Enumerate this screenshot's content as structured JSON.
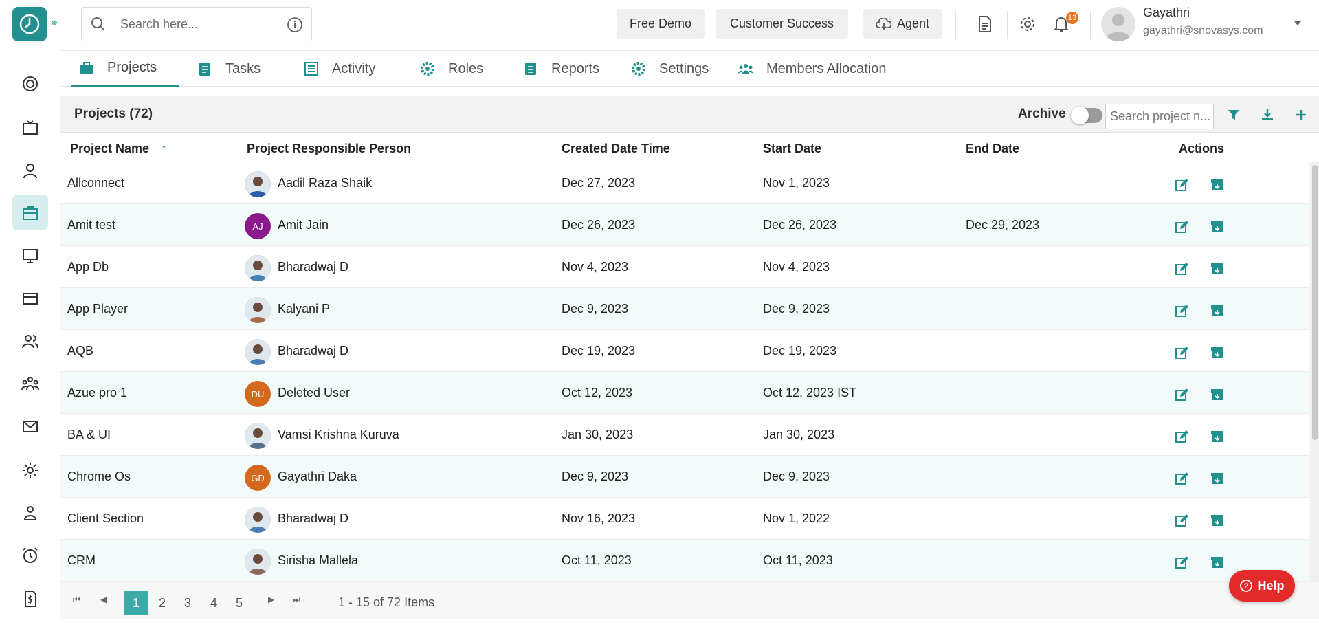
{
  "topbar": {
    "search_placeholder": "Search here...",
    "free_demo": "Free Demo",
    "customer_success": "Customer Success",
    "agent": "Agent",
    "notification_count": "13",
    "user_name": "Gayathri",
    "user_email": "gayathri@snovasys.com"
  },
  "tabs": [
    {
      "label": "Projects",
      "icon": "briefcase-icon"
    },
    {
      "label": "Tasks",
      "icon": "clipboard-icon"
    },
    {
      "label": "Activity",
      "icon": "list-icon"
    },
    {
      "label": "Roles",
      "icon": "gear-icon"
    },
    {
      "label": "Reports",
      "icon": "document-icon"
    },
    {
      "label": "Settings",
      "icon": "settings-icon"
    },
    {
      "label": "Members Allocation",
      "icon": "users-icon"
    }
  ],
  "panel": {
    "title": "Projects (72)",
    "archive_label": "Archive",
    "search_placeholder": "Search project n..."
  },
  "columns": [
    "Project Name",
    "Project Responsible Person",
    "Created Date Time",
    "Start Date",
    "End Date",
    "Actions"
  ],
  "rows": [
    {
      "name": "Allconnect",
      "person": "Aadil Raza Shaik",
      "initials": "",
      "avatar_color": "#2d5fa8",
      "created": "Dec 27, 2023",
      "start": "Nov 1, 2023",
      "end": ""
    },
    {
      "name": "Amit test",
      "person": "Amit Jain",
      "initials": "AJ",
      "avatar_color": "#8a1a8c",
      "created": "Dec 26, 2023",
      "start": "Dec 26, 2023",
      "end": "Dec 29, 2023"
    },
    {
      "name": "App Db",
      "person": "Bharadwaj D",
      "initials": "",
      "avatar_color": "#4a7fb5",
      "created": "Nov 4, 2023",
      "start": "Nov 4, 2023",
      "end": ""
    },
    {
      "name": "App Player",
      "person": "Kalyani P",
      "initials": "",
      "avatar_color": "#a8684c",
      "created": "Dec 9, 2023",
      "start": "Dec 9, 2023",
      "end": ""
    },
    {
      "name": "AQB",
      "person": "Bharadwaj D",
      "initials": "",
      "avatar_color": "#4a7fb5",
      "created": "Dec 19, 2023",
      "start": "Dec 19, 2023",
      "end": ""
    },
    {
      "name": "Azue pro 1",
      "person": "Deleted User",
      "initials": "DU",
      "avatar_color": "#d2691e",
      "created": "Oct 12, 2023",
      "start": "Oct 12, 2023 IST",
      "end": ""
    },
    {
      "name": "BA & UI",
      "person": "Vamsi Krishna Kuruva",
      "initials": "",
      "avatar_color": "#5a6f8a",
      "created": "Jan 30, 2023",
      "start": "Jan 30, 2023",
      "end": ""
    },
    {
      "name": "Chrome Os",
      "person": "Gayathri Daka",
      "initials": "GD",
      "avatar_color": "#d2691e",
      "created": "Dec 9, 2023",
      "start": "Dec 9, 2023",
      "end": ""
    },
    {
      "name": "Client Section",
      "person": "Bharadwaj D",
      "initials": "",
      "avatar_color": "#4a7fb5",
      "created": "Nov 16, 2023",
      "start": "Nov 1, 2022",
      "end": ""
    },
    {
      "name": "CRM",
      "person": "Sirisha Mallela",
      "initials": "",
      "avatar_color": "#8a6a5a",
      "created": "Oct 11, 2023",
      "start": "Oct 11, 2023",
      "end": ""
    }
  ],
  "pager": {
    "pages": [
      "1",
      "2",
      "3",
      "4",
      "5"
    ],
    "info": "1 - 15 of 72 Items"
  },
  "help_label": "Help",
  "colors": {
    "accent": "#22908f",
    "highlight": "#e11d2b",
    "help": "#e42b2b"
  }
}
